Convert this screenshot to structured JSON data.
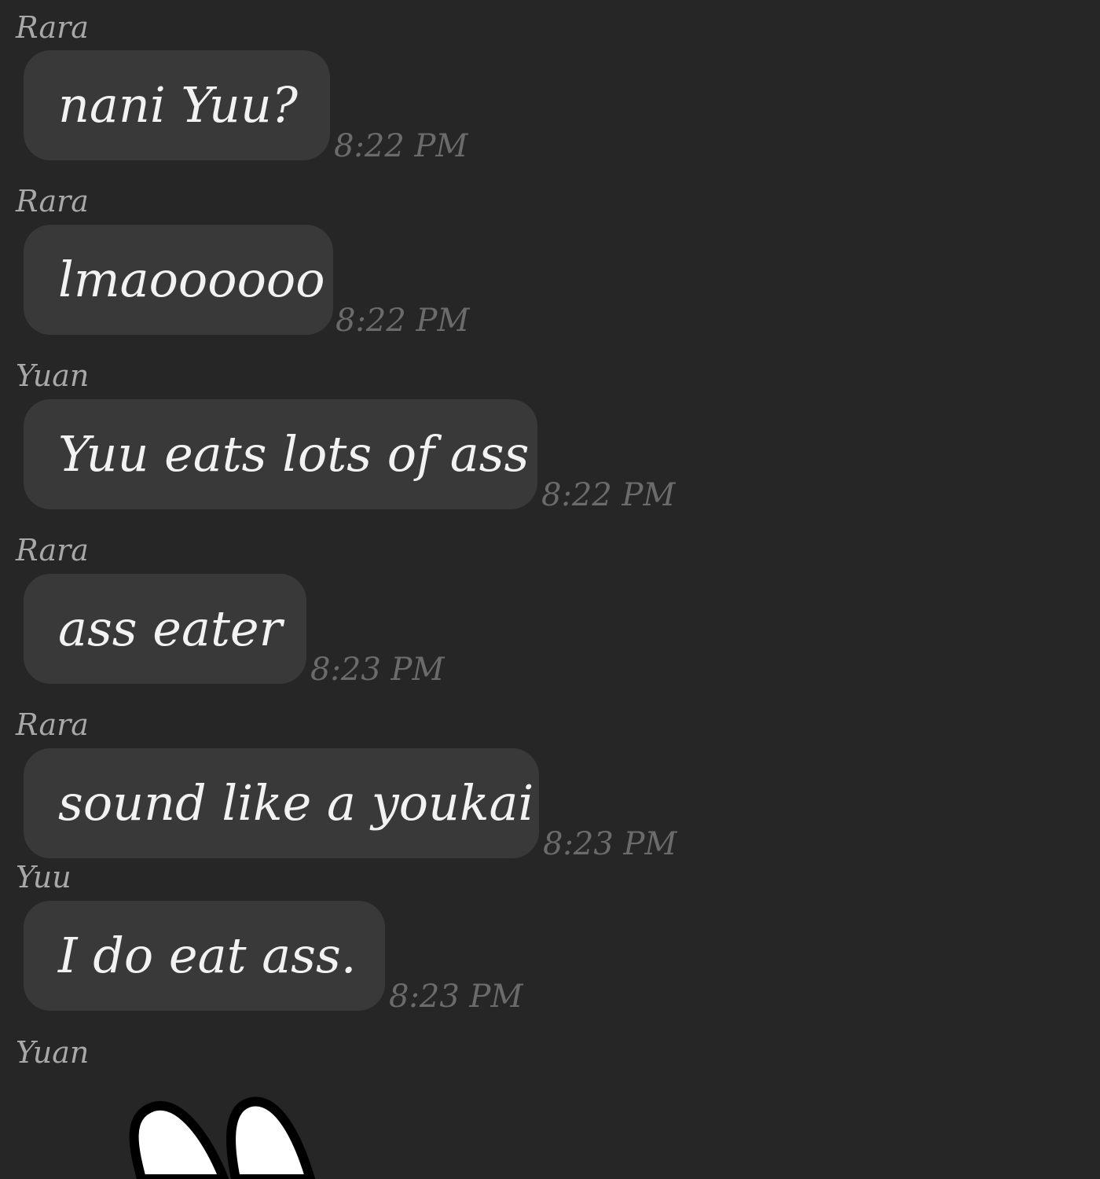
{
  "messages": [
    {
      "sender": "Rara",
      "text": "nani Yuu?",
      "time": "8:22 PM"
    },
    {
      "sender": "Rara",
      "text": "lmaoooooo",
      "time": "8:22 PM"
    },
    {
      "sender": "Yuan",
      "text": "Yuu eats lots of ass",
      "time": "8:22 PM"
    },
    {
      "sender": "Rara",
      "text": "ass eater",
      "time": "8:23 PM"
    },
    {
      "sender": "Rara",
      "text": "sound like a youkai",
      "time": "8:23 PM"
    },
    {
      "sender": "Yuu",
      "text": "I do eat ass.",
      "time": "8:23 PM"
    },
    {
      "sender": "Yuan",
      "sticker": "bunny-ears-sticker"
    }
  ],
  "colors": {
    "background": "#262626",
    "bubble": "#393939",
    "text": "#f2f2f2",
    "sender": "#a8a8a8",
    "time": "#6b6b6b"
  }
}
